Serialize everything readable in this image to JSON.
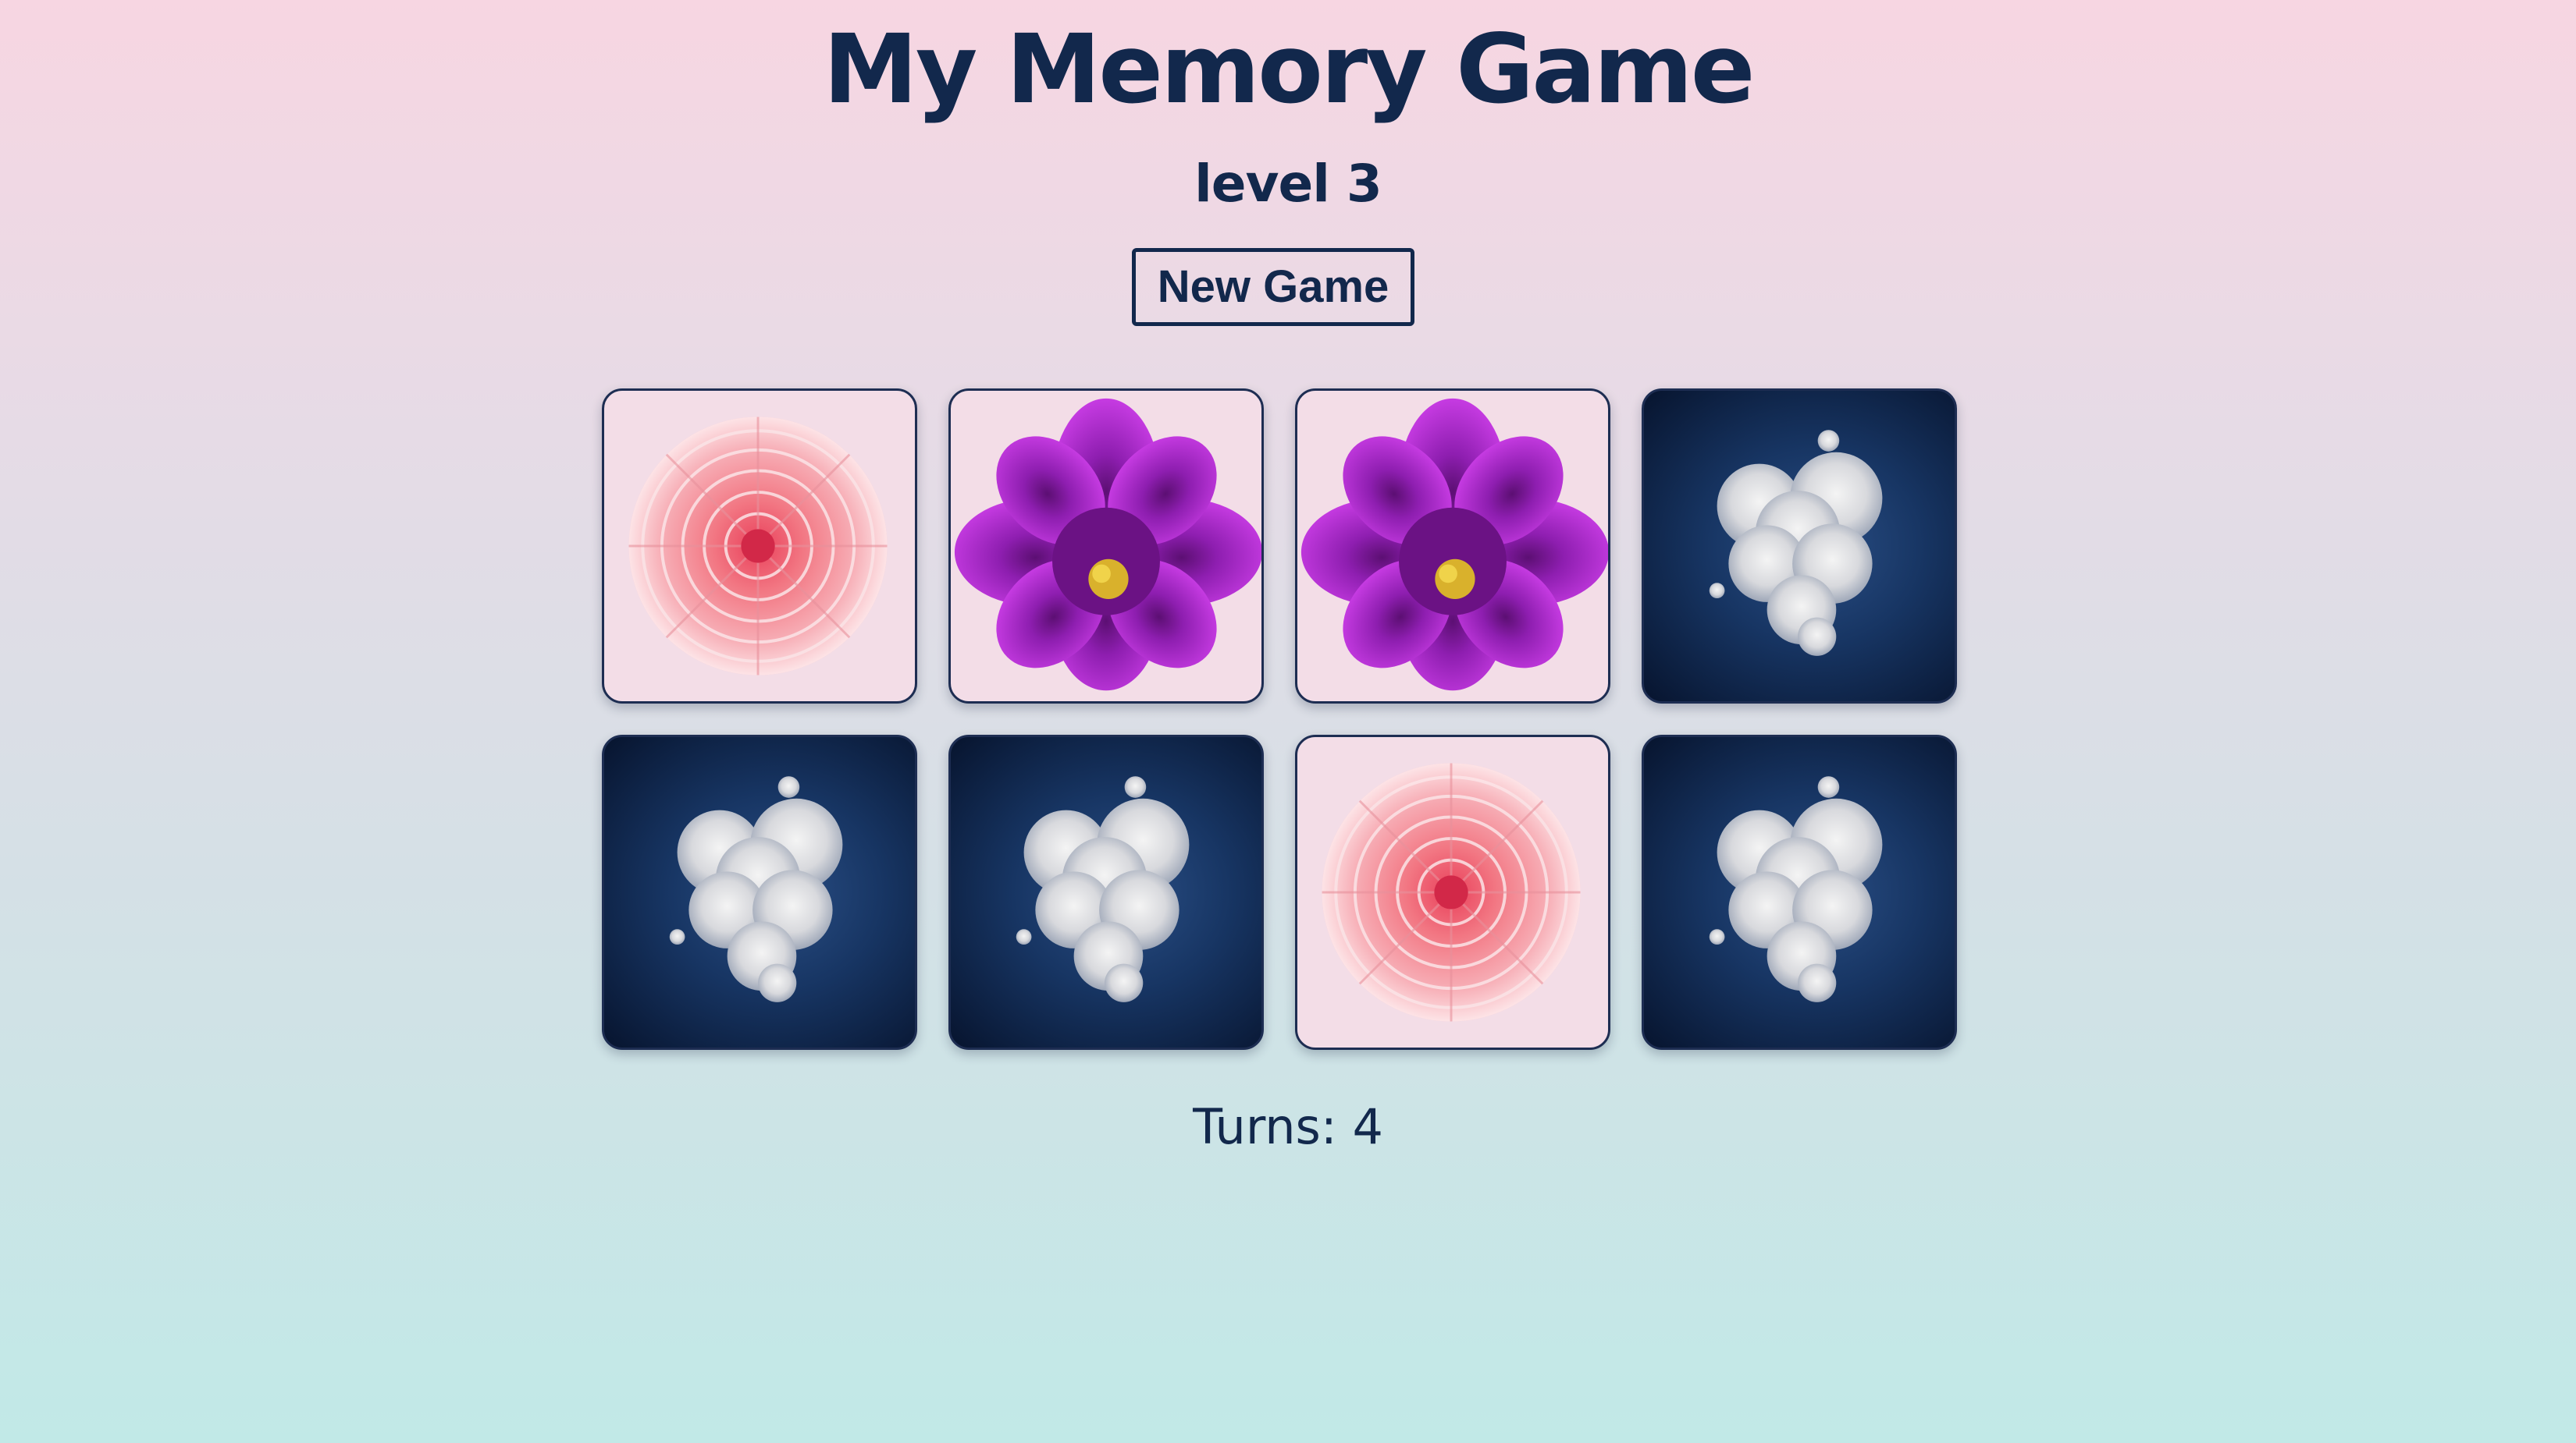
{
  "header": {
    "title": "My Memory Game",
    "level": "level 3",
    "new_game_label": "New Game"
  },
  "board": {
    "cards": [
      {
        "state": "revealed",
        "image": "pink-dahlia"
      },
      {
        "state": "revealed",
        "image": "purple-dahlia"
      },
      {
        "state": "revealed",
        "image": "purple-dahlia"
      },
      {
        "state": "hidden",
        "image": "cloud-heart-back"
      },
      {
        "state": "hidden",
        "image": "cloud-heart-back"
      },
      {
        "state": "hidden",
        "image": "cloud-heart-back"
      },
      {
        "state": "revealed",
        "image": "pink-dahlia"
      },
      {
        "state": "hidden",
        "image": "cloud-heart-back"
      }
    ]
  },
  "status": {
    "turns": "Turns: 4"
  },
  "colors": {
    "text": "#12284c",
    "card_face_bg": "#f3dde7",
    "card_back_bg": "#173563",
    "pink_flower": "#f38a93",
    "purple_flower": "#a325c4"
  }
}
